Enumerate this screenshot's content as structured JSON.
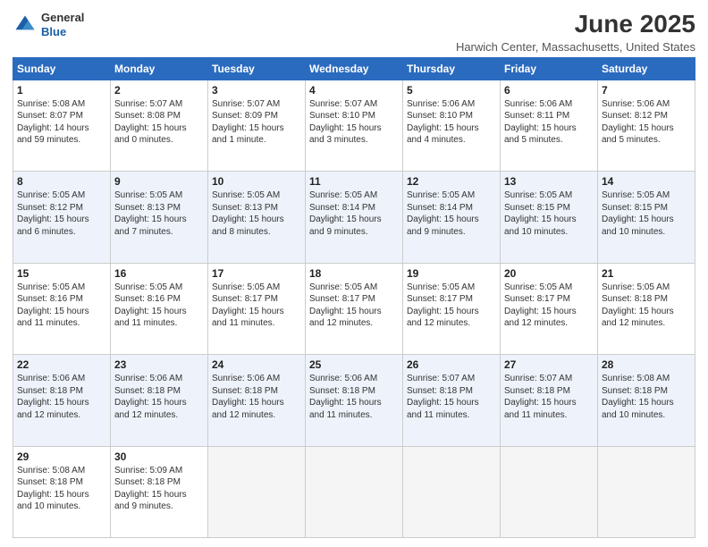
{
  "header": {
    "logo_general": "General",
    "logo_blue": "Blue",
    "month": "June 2025",
    "location": "Harwich Center, Massachusetts, United States"
  },
  "days_of_week": [
    "Sunday",
    "Monday",
    "Tuesday",
    "Wednesday",
    "Thursday",
    "Friday",
    "Saturday"
  ],
  "weeks": [
    {
      "class": "row-odd",
      "days": [
        {
          "num": "1",
          "lines": [
            "Sunrise: 5:08 AM",
            "Sunset: 8:07 PM",
            "Daylight: 14 hours",
            "and 59 minutes."
          ]
        },
        {
          "num": "2",
          "lines": [
            "Sunrise: 5:07 AM",
            "Sunset: 8:08 PM",
            "Daylight: 15 hours",
            "and 0 minutes."
          ]
        },
        {
          "num": "3",
          "lines": [
            "Sunrise: 5:07 AM",
            "Sunset: 8:09 PM",
            "Daylight: 15 hours",
            "and 1 minute."
          ]
        },
        {
          "num": "4",
          "lines": [
            "Sunrise: 5:07 AM",
            "Sunset: 8:10 PM",
            "Daylight: 15 hours",
            "and 3 minutes."
          ]
        },
        {
          "num": "5",
          "lines": [
            "Sunrise: 5:06 AM",
            "Sunset: 8:10 PM",
            "Daylight: 15 hours",
            "and 4 minutes."
          ]
        },
        {
          "num": "6",
          "lines": [
            "Sunrise: 5:06 AM",
            "Sunset: 8:11 PM",
            "Daylight: 15 hours",
            "and 5 minutes."
          ]
        },
        {
          "num": "7",
          "lines": [
            "Sunrise: 5:06 AM",
            "Sunset: 8:12 PM",
            "Daylight: 15 hours",
            "and 5 minutes."
          ]
        }
      ]
    },
    {
      "class": "row-even",
      "days": [
        {
          "num": "8",
          "lines": [
            "Sunrise: 5:05 AM",
            "Sunset: 8:12 PM",
            "Daylight: 15 hours",
            "and 6 minutes."
          ]
        },
        {
          "num": "9",
          "lines": [
            "Sunrise: 5:05 AM",
            "Sunset: 8:13 PM",
            "Daylight: 15 hours",
            "and 7 minutes."
          ]
        },
        {
          "num": "10",
          "lines": [
            "Sunrise: 5:05 AM",
            "Sunset: 8:13 PM",
            "Daylight: 15 hours",
            "and 8 minutes."
          ]
        },
        {
          "num": "11",
          "lines": [
            "Sunrise: 5:05 AM",
            "Sunset: 8:14 PM",
            "Daylight: 15 hours",
            "and 9 minutes."
          ]
        },
        {
          "num": "12",
          "lines": [
            "Sunrise: 5:05 AM",
            "Sunset: 8:14 PM",
            "Daylight: 15 hours",
            "and 9 minutes."
          ]
        },
        {
          "num": "13",
          "lines": [
            "Sunrise: 5:05 AM",
            "Sunset: 8:15 PM",
            "Daylight: 15 hours",
            "and 10 minutes."
          ]
        },
        {
          "num": "14",
          "lines": [
            "Sunrise: 5:05 AM",
            "Sunset: 8:15 PM",
            "Daylight: 15 hours",
            "and 10 minutes."
          ]
        }
      ]
    },
    {
      "class": "row-odd",
      "days": [
        {
          "num": "15",
          "lines": [
            "Sunrise: 5:05 AM",
            "Sunset: 8:16 PM",
            "Daylight: 15 hours",
            "and 11 minutes."
          ]
        },
        {
          "num": "16",
          "lines": [
            "Sunrise: 5:05 AM",
            "Sunset: 8:16 PM",
            "Daylight: 15 hours",
            "and 11 minutes."
          ]
        },
        {
          "num": "17",
          "lines": [
            "Sunrise: 5:05 AM",
            "Sunset: 8:17 PM",
            "Daylight: 15 hours",
            "and 11 minutes."
          ]
        },
        {
          "num": "18",
          "lines": [
            "Sunrise: 5:05 AM",
            "Sunset: 8:17 PM",
            "Daylight: 15 hours",
            "and 12 minutes."
          ]
        },
        {
          "num": "19",
          "lines": [
            "Sunrise: 5:05 AM",
            "Sunset: 8:17 PM",
            "Daylight: 15 hours",
            "and 12 minutes."
          ]
        },
        {
          "num": "20",
          "lines": [
            "Sunrise: 5:05 AM",
            "Sunset: 8:17 PM",
            "Daylight: 15 hours",
            "and 12 minutes."
          ]
        },
        {
          "num": "21",
          "lines": [
            "Sunrise: 5:05 AM",
            "Sunset: 8:18 PM",
            "Daylight: 15 hours",
            "and 12 minutes."
          ]
        }
      ]
    },
    {
      "class": "row-even",
      "days": [
        {
          "num": "22",
          "lines": [
            "Sunrise: 5:06 AM",
            "Sunset: 8:18 PM",
            "Daylight: 15 hours",
            "and 12 minutes."
          ]
        },
        {
          "num": "23",
          "lines": [
            "Sunrise: 5:06 AM",
            "Sunset: 8:18 PM",
            "Daylight: 15 hours",
            "and 12 minutes."
          ]
        },
        {
          "num": "24",
          "lines": [
            "Sunrise: 5:06 AM",
            "Sunset: 8:18 PM",
            "Daylight: 15 hours",
            "and 12 minutes."
          ]
        },
        {
          "num": "25",
          "lines": [
            "Sunrise: 5:06 AM",
            "Sunset: 8:18 PM",
            "Daylight: 15 hours",
            "and 11 minutes."
          ]
        },
        {
          "num": "26",
          "lines": [
            "Sunrise: 5:07 AM",
            "Sunset: 8:18 PM",
            "Daylight: 15 hours",
            "and 11 minutes."
          ]
        },
        {
          "num": "27",
          "lines": [
            "Sunrise: 5:07 AM",
            "Sunset: 8:18 PM",
            "Daylight: 15 hours",
            "and 11 minutes."
          ]
        },
        {
          "num": "28",
          "lines": [
            "Sunrise: 5:08 AM",
            "Sunset: 8:18 PM",
            "Daylight: 15 hours",
            "and 10 minutes."
          ]
        }
      ]
    },
    {
      "class": "row-odd",
      "days": [
        {
          "num": "29",
          "lines": [
            "Sunrise: 5:08 AM",
            "Sunset: 8:18 PM",
            "Daylight: 15 hours",
            "and 10 minutes."
          ]
        },
        {
          "num": "30",
          "lines": [
            "Sunrise: 5:09 AM",
            "Sunset: 8:18 PM",
            "Daylight: 15 hours",
            "and 9 minutes."
          ]
        },
        {
          "num": "",
          "lines": [],
          "empty": true
        },
        {
          "num": "",
          "lines": [],
          "empty": true
        },
        {
          "num": "",
          "lines": [],
          "empty": true
        },
        {
          "num": "",
          "lines": [],
          "empty": true
        },
        {
          "num": "",
          "lines": [],
          "empty": true
        }
      ]
    }
  ]
}
